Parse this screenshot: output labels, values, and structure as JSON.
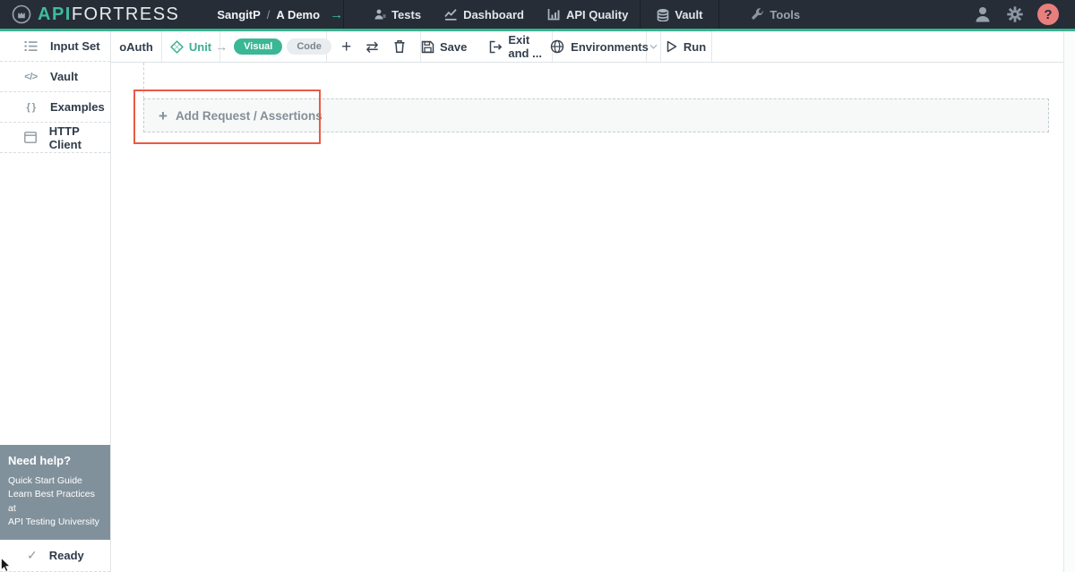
{
  "colors": {
    "accent_teal": "#3cb392",
    "navbar_bg": "#262d37",
    "annotation_red": "#e95b43",
    "help_badge_red": "#e87f7d",
    "help_box_gray": "#81919c",
    "visual_pill_teal": "#3cb795"
  },
  "navbar": {
    "logo": {
      "api": "API",
      "fortress": "FORTRESS"
    },
    "breadcrumb": {
      "user": "SangitP",
      "separator": "/",
      "project": "A Demo",
      "arrow": "→"
    },
    "items": [
      {
        "label": "Tests"
      },
      {
        "label": "Dashboard"
      },
      {
        "label": "API Quality"
      },
      {
        "label": "Vault"
      },
      {
        "label": "Tools"
      }
    ],
    "help_glyph": "?"
  },
  "toolbar": {
    "oauth_label": "oAuth",
    "unit_label": "Unit",
    "arrow_glyph": "→",
    "visual_label": "Visual",
    "code_label": "Code",
    "plus_glyph": "+",
    "swap_glyph": "⇄",
    "save_label": "Save",
    "exit_label": "Exit and ...",
    "environments_label": "Environments",
    "run_label": "Run"
  },
  "sidebar": {
    "items": [
      {
        "label": "Input Set"
      },
      {
        "label": "Vault",
        "icon_glyph": "</>"
      },
      {
        "label": "Examples",
        "icon_glyph": "{ }"
      },
      {
        "label": "HTTP Client"
      }
    ],
    "help_box": {
      "title": "Need help?",
      "links": [
        "Quick Start Guide",
        "Learn Best Practices at",
        "API Testing University"
      ]
    },
    "status": {
      "check_glyph": "✓",
      "label": "Ready"
    }
  },
  "main": {
    "add_button": {
      "plus_glyph": "+",
      "label": "Add Request / Assertions"
    }
  }
}
